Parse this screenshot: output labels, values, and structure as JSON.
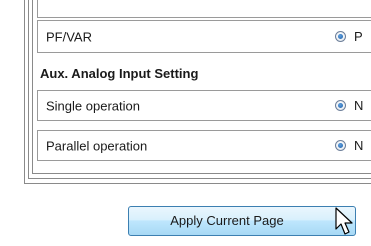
{
  "rows_top": {
    "pf_var": {
      "label": "PF/VAR",
      "option": "P"
    }
  },
  "section": {
    "title": "Aux. Analog Input Setting",
    "rows": [
      {
        "label": "Single operation",
        "option": "N"
      },
      {
        "label": "Parallel operation",
        "option": "N"
      }
    ]
  },
  "apply_button": {
    "label": "Apply Current Page"
  },
  "cursor": {
    "icon": "arrow-pointer-icon"
  }
}
